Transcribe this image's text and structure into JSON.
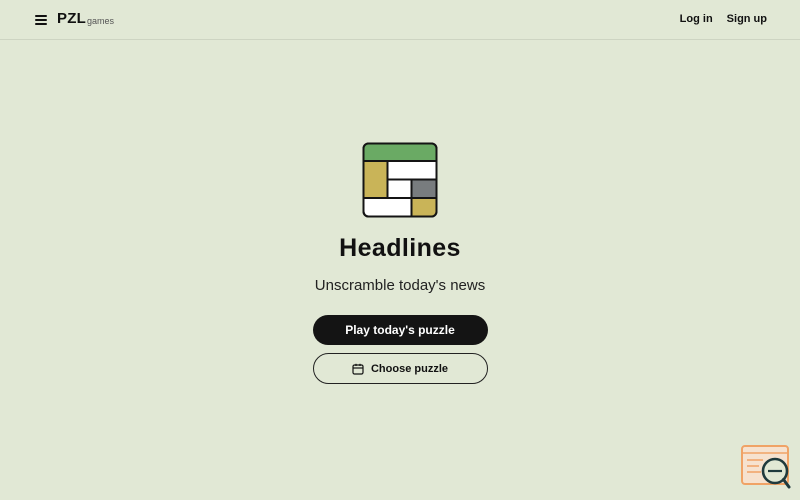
{
  "header": {
    "menu_icon": "hamburger-menu-icon",
    "logo_main": "PZL",
    "logo_sub": "games",
    "login_label": "Log in",
    "signup_label": "Sign up"
  },
  "game": {
    "logo_icon": "headlines-grid-logo",
    "title": "Headlines",
    "tagline": "Unscramble today's news",
    "play_label": "Play today's puzzle",
    "choose_label": "Choose puzzle",
    "choose_icon": "calendar-icon"
  },
  "feedback_widget": {
    "icon": "feedback-search-icon"
  },
  "colors": {
    "background": "#e1e8d5",
    "green": "#6aaa64",
    "gold": "#c9b458",
    "gray": "#787c7e",
    "dark": "#141414",
    "feedback_orange": "#f0a366",
    "feedback_teal": "#1f3a3d"
  }
}
